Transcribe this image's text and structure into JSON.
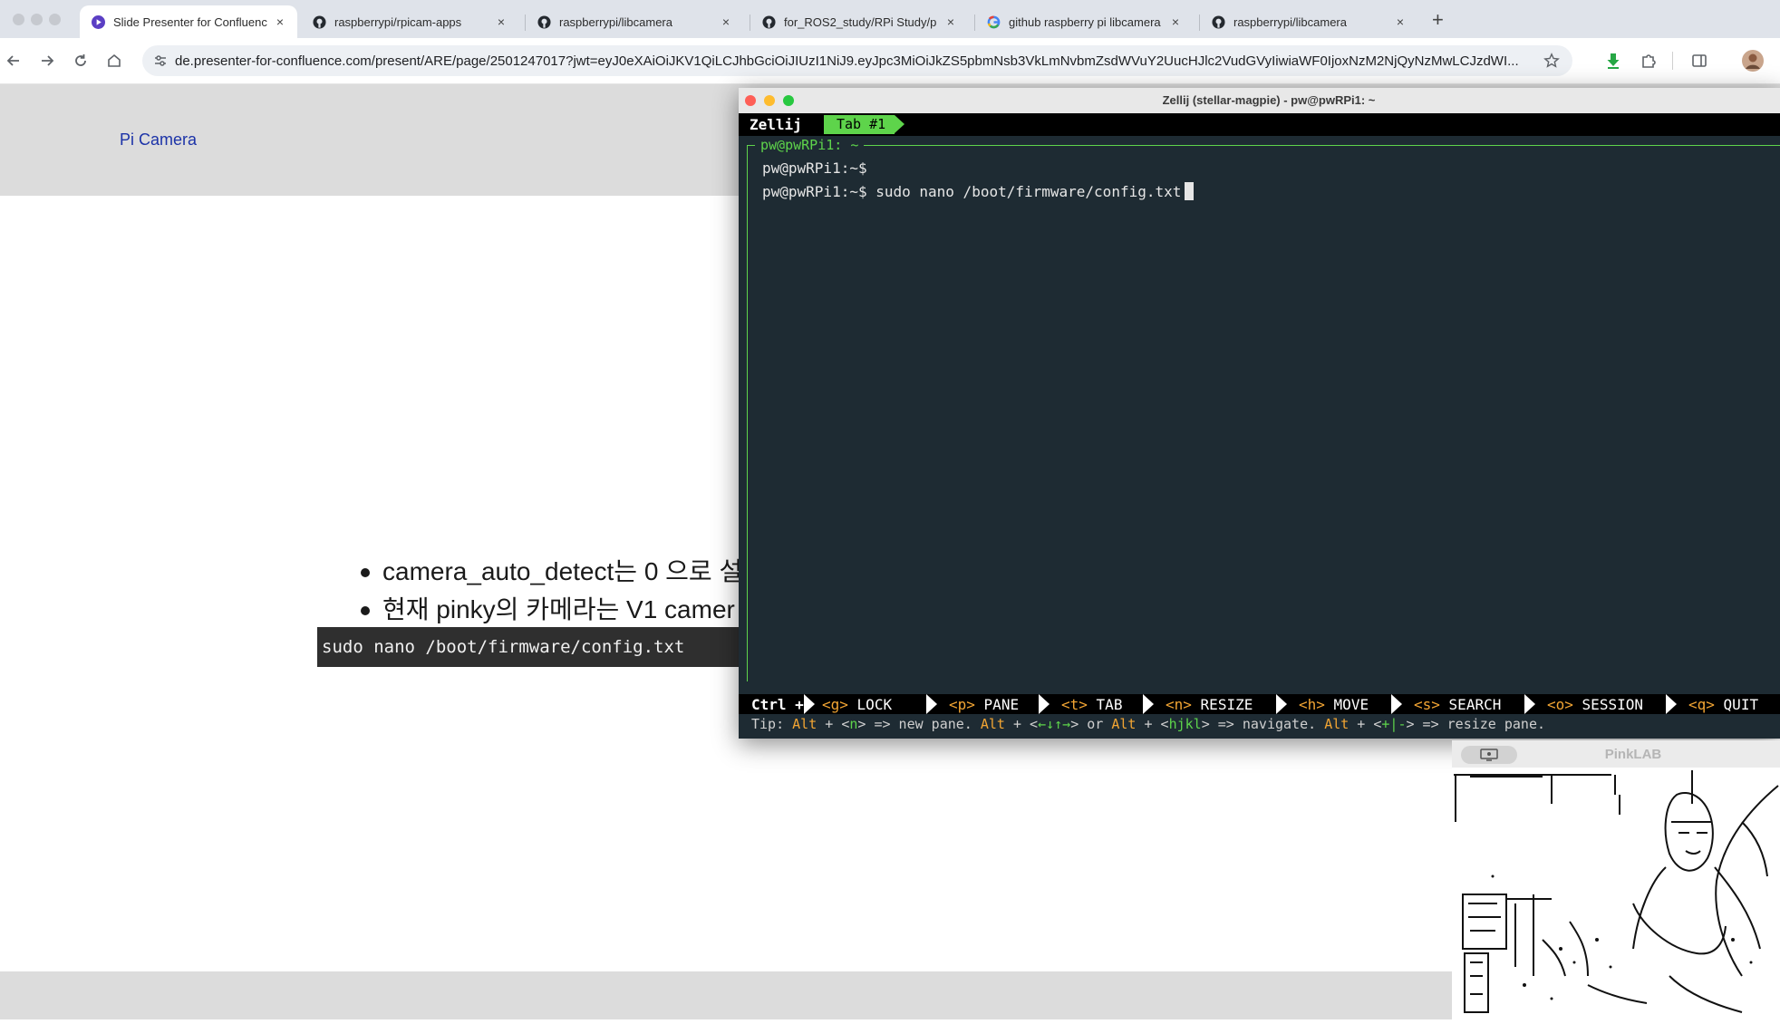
{
  "browser": {
    "tabs": [
      {
        "label": "Slide Presenter for Confluenc",
        "icon": "presenter-icon",
        "active": true
      },
      {
        "label": "raspberrypi/rpicam-apps",
        "icon": "github-icon",
        "active": false
      },
      {
        "label": "raspberrypi/libcamera",
        "icon": "github-icon",
        "active": false
      },
      {
        "label": "for_ROS2_study/RPi Study/p",
        "icon": "github-icon",
        "active": false
      },
      {
        "label": "github raspberry pi libcamera",
        "icon": "google-icon",
        "active": false
      },
      {
        "label": "raspberrypi/libcamera",
        "icon": "github-icon",
        "active": false
      }
    ],
    "tab_close_glyph": "×",
    "new_tab_glyph": "+",
    "url": "de.presenter-for-confluence.com/present/ARE/page/2501247017?jwt=eyJ0eXAiOiJKV1QiLCJhbGciOiJIUzI1NiJ9.eyJpc3MiOiJkZS5pbmNsb3VkLmNvbmZsdWVuY2UucHJlc2VudGVyIiwiaWF0IjoxNzM2NjQyNzMwLCJzdWI..."
  },
  "slide": {
    "title": "Pi Camera",
    "bullets": [
      "camera_auto_detect는 0 으로 설",
      "현재 pinky의 카메라는 V1 camer"
    ],
    "code": "sudo nano /boot/firmware/config.txt"
  },
  "terminal": {
    "window_title": "Zellij (stellar-magpie) - pw@pwRPi1: ~",
    "app_name": "Zellij",
    "tab_label": "Tab #1",
    "pane_title": "pw@pwRPi1: ~",
    "lines": [
      "pw@pwRPi1:~$",
      "pw@pwRPi1:~$ sudo nano /boot/firmware/config.txt"
    ],
    "status": {
      "ctrl": "Ctrl +",
      "items": [
        {
          "key": "<g>",
          "label": "LOCK"
        },
        {
          "key": "<p>",
          "label": "PANE"
        },
        {
          "key": "<t>",
          "label": "TAB"
        },
        {
          "key": "<n>",
          "label": "RESIZE"
        },
        {
          "key": "<h>",
          "label": "MOVE"
        },
        {
          "key": "<s>",
          "label": "SEARCH"
        },
        {
          "key": "<o>",
          "label": "SESSION"
        },
        {
          "key": "<q>",
          "label": "QUIT"
        }
      ]
    },
    "tip": {
      "prefix": "Tip: ",
      "alt": "Alt",
      "plus": " + <",
      "n": "n",
      "t1": "> => new pane. ",
      "arrows": "←↓↑→",
      "t2": "> or ",
      "hjkl": "hjkl",
      "t3": "> => navigate. ",
      "plusminus": "+|-",
      "t4": "> => resize pane."
    }
  },
  "webcam": {
    "title": "PinkLAB"
  },
  "colors": {
    "zellij_green": "#5ed44b",
    "zellij_orange": "#f2a533",
    "terminal_bg": "#1e2b33",
    "slide_title_blue": "#1c33a8"
  }
}
